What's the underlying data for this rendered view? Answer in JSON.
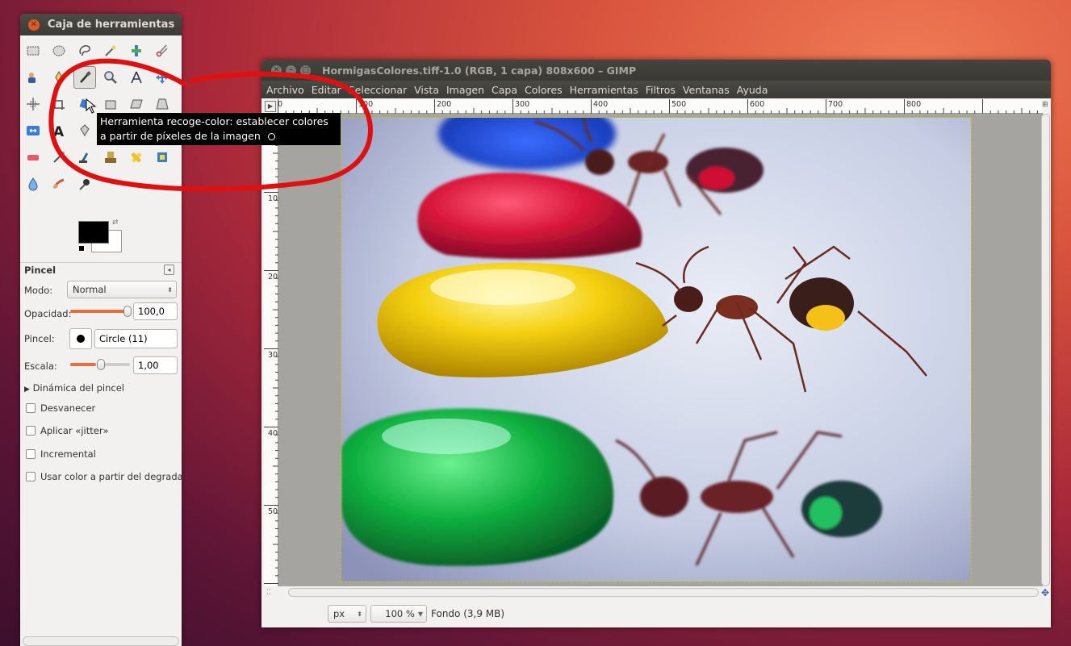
{
  "toolbox": {
    "title": "Caja de herramientas",
    "options": {
      "tool_name": "Pincel",
      "mode_label": "Modo:",
      "mode_value": "Normal",
      "opacity_label": "Opacidad:",
      "opacity_value": "100,0",
      "opacity_fraction": 1.0,
      "brush_label": "Pincel:",
      "brush_value": "Circle (11)",
      "scale_label": "Escala:",
      "scale_value": "1,00",
      "dynamics_label": "Dinámica del pincel",
      "checks": [
        {
          "label": "Desvanecer",
          "checked": false
        },
        {
          "label": "Aplicar «jitter»",
          "checked": false
        },
        {
          "label": "Incremental",
          "checked": false
        },
        {
          "label": "Usar color a partir del degradado",
          "checked": false
        }
      ]
    },
    "colors": {
      "foreground": "#000000",
      "background": "#ffffff"
    }
  },
  "image_window": {
    "title": "HormigasColores.tiff-1.0 (RGB, 1 capa) 808x600 – GIMP",
    "menu": [
      "Archivo",
      "Editar",
      "Seleccionar",
      "Vista",
      "Imagen",
      "Capa",
      "Colores",
      "Herramientas",
      "Filtros",
      "Ventanas",
      "Ayuda"
    ],
    "ruler_h": [
      "0",
      "100",
      "200",
      "300",
      "400",
      "500",
      "600",
      "700",
      "800"
    ],
    "ruler_v": [
      "100",
      "200",
      "300",
      "400",
      "500"
    ],
    "status": {
      "unit": "px",
      "zoom": "100 %",
      "layer_info": "Fondo (3,9 MB)"
    }
  },
  "tooltip": {
    "line1": "Herramienta recoge-color: establecer colores",
    "line2": "a partir de píxeles de la imagen"
  },
  "accent_color": "#e6703a",
  "annotation_color": "#e01010"
}
